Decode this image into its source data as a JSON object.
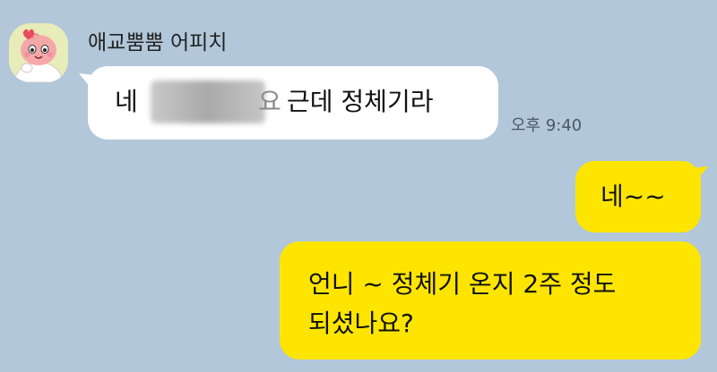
{
  "chat": {
    "sender_name": "애교뿜뿜 어피치",
    "incoming": {
      "text_before": "네",
      "text_blur_edge": "요",
      "text_after": "근데 정체기라",
      "time": "오후 9:40"
    },
    "outgoing": [
      {
        "text": "네~~"
      },
      {
        "line1": "언니 ~ 정체기 온지 2주 정도",
        "line2": "되셨나요?"
      }
    ]
  },
  "colors": {
    "background": "#b2c7d9",
    "incoming_bubble": "#ffffff",
    "outgoing_bubble": "#fee500"
  },
  "icons": {
    "avatar": "apeach-emoticon"
  }
}
